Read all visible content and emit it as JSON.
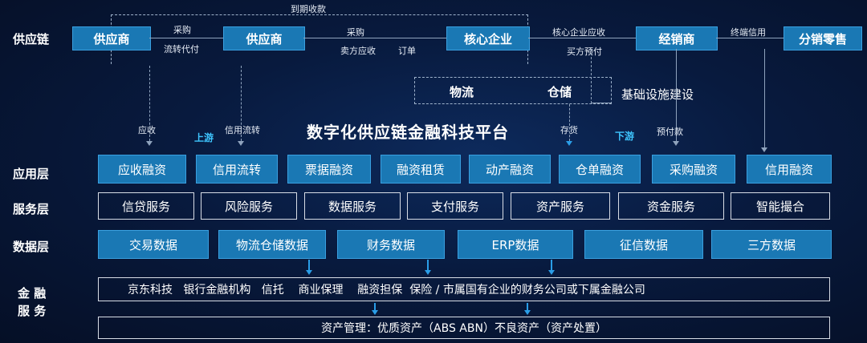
{
  "row_labels": {
    "supply_chain": "供应链",
    "application": "应用层",
    "service": "服务层",
    "data": "数据层",
    "finance_1": "金 融",
    "finance_2": "服 务"
  },
  "supply_chain": {
    "nodes": [
      "供应商",
      "供应商",
      "核心企业",
      "经销商",
      "分销零售"
    ],
    "labels": {
      "top": "到期收款",
      "caigou_1": "采购",
      "liuzhuan": "流转代付",
      "caigou_2": "采购",
      "maifang_yingshou": "卖方应收",
      "dingdan": "订单",
      "hexin_yingshou": "核心企业应收",
      "maifang_yufu": "买方预付",
      "zhongduan": "终端信用"
    }
  },
  "infrastructure": {
    "wuliu": "物流",
    "cangchu": "仓储",
    "label": "基础设施建设"
  },
  "platform_title": "数字化供应链金融科技平台",
  "flow_labels": {
    "yingshou": "应收",
    "shangyou": "上游",
    "xinyong_liuzhuan": "信用流转",
    "cunhuo": "存货",
    "xiayou": "下游",
    "yufukuan": "预付款"
  },
  "application_layer": [
    "应收融资",
    "信用流转",
    "票据融资",
    "融资租赁",
    "动产融资",
    "仓单融资",
    "采购融资",
    "信用融资"
  ],
  "service_layer": [
    "信贷服务",
    "风险服务",
    "数据服务",
    "支付服务",
    "资产服务",
    "资金服务",
    "智能撮合"
  ],
  "data_layer": [
    "交易数据",
    "物流仓储数据",
    "财务数据",
    "ERP数据",
    "征信数据",
    "三方数据"
  ],
  "finance_service": {
    "institutions": "京东科技   银行金融机构   信托    商业保理    融资担保  保险 / 市属国有企业的财务公司或下属金融公司",
    "asset_mgmt": "资产管理：优质资产（ABS ABN）不良资产（资产处置）"
  }
}
